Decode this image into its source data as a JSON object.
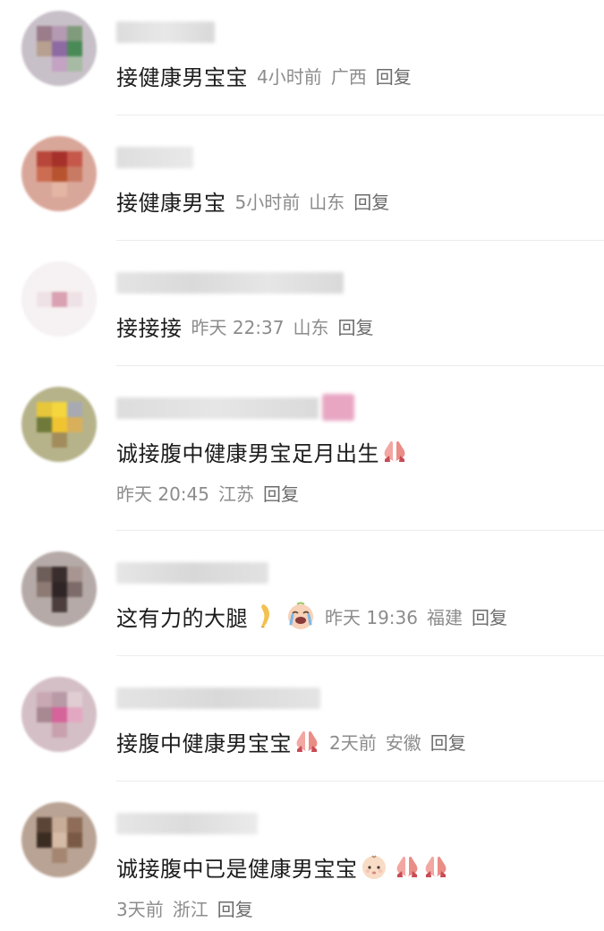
{
  "comments": [
    {
      "text": "接健康男宝宝",
      "time": "4小时前",
      "location": "广西",
      "reply": "回复"
    },
    {
      "text": "接健康男宝",
      "time": "5小时前",
      "location": "山东",
      "reply": "回复"
    },
    {
      "text": "接接接",
      "time": "昨天 22:37",
      "location": "山东",
      "reply": "回复"
    },
    {
      "text": "诚接腹中健康男宝足月出生",
      "time": "昨天 20:45",
      "location": "江苏",
      "reply": "回复"
    },
    {
      "text": "这有力的大腿",
      "time": "昨天 19:36",
      "location": "福建",
      "reply": "回复"
    },
    {
      "text": "接腹中健康男宝宝",
      "time": "2天前",
      "location": "安徽",
      "reply": "回复"
    },
    {
      "text": "诚接腹中已是健康男宝宝",
      "time": "3天前",
      "location": "浙江",
      "reply": "回复"
    }
  ],
  "emoji_names": [
    "praying-hands-icon",
    "leg-icon",
    "crying-face-icon",
    "baby-face-icon"
  ]
}
